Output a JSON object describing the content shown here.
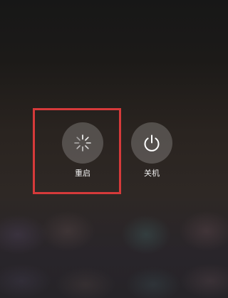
{
  "power_menu": {
    "restart": {
      "label": "重启",
      "icon": "restart-spinner-icon"
    },
    "shutdown": {
      "label": "关机",
      "icon": "power-icon"
    }
  },
  "annotation": {
    "highlight_color": "#d63a3a",
    "highlighted_item": "restart"
  },
  "colors": {
    "button_fill": "rgba(255,255,255,0.2)",
    "label_text": "#f2f2f2"
  }
}
